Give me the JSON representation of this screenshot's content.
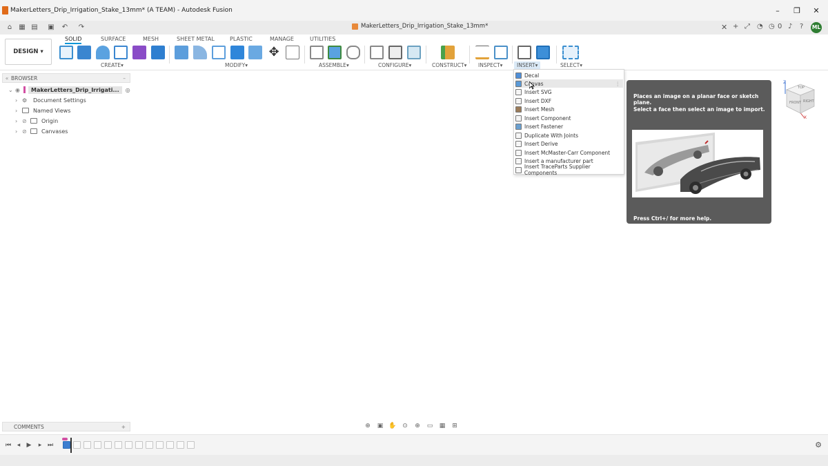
{
  "window": {
    "title": "MakerLetters_Drip_Irrigation_Stake_13mm* (A TEAM) - Autodesk Fusion",
    "minimize": "–",
    "maximize": "❐",
    "close": "✕"
  },
  "tabbar": {
    "doc_tab": "MakerLetters_Drip_Irrigation_Stake_13mm*",
    "tab_close": "✕",
    "badge_count": "0",
    "avatar": "ML"
  },
  "toolbar": {
    "design_label": "DESIGN",
    "design_chevron": "▾",
    "workspace_tabs": [
      "SOLID",
      "SURFACE",
      "MESH",
      "SHEET METAL",
      "PLASTIC",
      "MANAGE",
      "UTILITIES"
    ],
    "groups": [
      "CREATE",
      "MODIFY",
      "ASSEMBLE",
      "CONFIGURE",
      "CONSTRUCT",
      "INSPECT",
      "INSERT",
      "SELECT"
    ],
    "group_suffix": "▾"
  },
  "browser": {
    "header": "BROWSER",
    "collapse": "–",
    "root": "MakerLetters_Drip_Irrigati...",
    "items": [
      "Document Settings",
      "Named Views",
      "Origin",
      "Canvases"
    ]
  },
  "insert_menu": {
    "items": [
      "Decal",
      "Canvas",
      "Insert SVG",
      "Insert DXF",
      "Insert Mesh",
      "Insert Component",
      "Insert Fastener",
      "Duplicate With Joints",
      "Insert Derive",
      "Insert McMaster-Carr Component",
      "Insert a manufacturer part",
      "Insert TraceParts Supplier Components"
    ],
    "hovered": "Canvas",
    "kebab": "⋮"
  },
  "tooltip": {
    "line1": "Places an image on a planar face or sketch plane.",
    "line2": "Select a face then select an image to import.",
    "footer": "Press Ctrl+/ for more help."
  },
  "viewcube": {
    "top": "TOP",
    "front": "FRONT",
    "right": "RIGHT",
    "z_axis": "Z",
    "x_axis": "X"
  },
  "comments": {
    "header": "COMMENTS",
    "add": "+"
  },
  "colors": {
    "accent": "#0696d7",
    "tooltip_bg": "#5b5b5b",
    "app_icon": "#e06b1a",
    "avatar": "#2e7d32"
  }
}
